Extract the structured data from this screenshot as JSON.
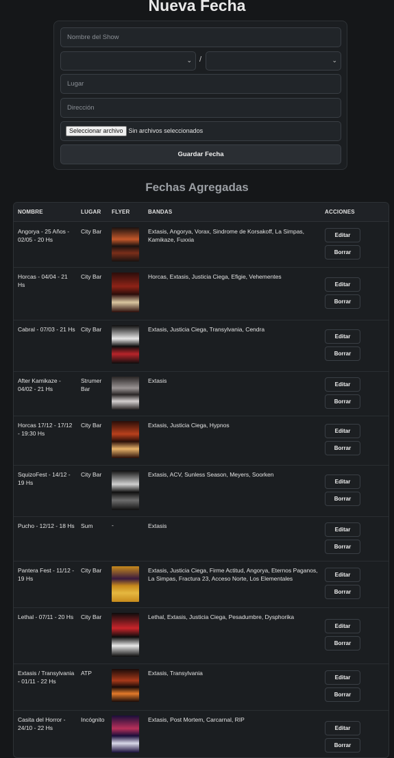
{
  "page": {
    "title": "Nueva Fecha"
  },
  "form": {
    "name_placeholder": "Nombre del Show",
    "separator": "/",
    "place_placeholder": "Lugar",
    "address_placeholder": "Dirección",
    "file_button": "Seleccionar archivo",
    "file_status": "Sin archivos seleccionados",
    "save_label": "Guardar Fecha"
  },
  "list": {
    "title": "Fechas Agregadas",
    "headers": {
      "name": "NOMBRE",
      "place": "LUGAR",
      "flyer": "FLYER",
      "bands": "BANDAS",
      "actions": "ACCIONES"
    },
    "edit_label": "Editar",
    "delete_label": "Borrar",
    "no_flyer": "-",
    "rows": [
      {
        "name": "Angorya - 25 Años - 02/05 - 20 Hs",
        "place": "City Bar",
        "bands": "Extasis, Angorya, Vorax, Sindrome de Korsakoff, La Simpas, Kamikaze, Fuxxia",
        "flyer_colors": [
          "#1a1210",
          "#c4582a",
          "#7a2e1a"
        ]
      },
      {
        "name": "Horcas - 04/04 - 21 Hs",
        "place": "City Bar",
        "bands": "Horcas, Extasis, Justicia Ciega, Efigie, Vehementes",
        "flyer_colors": [
          "#2b0d0a",
          "#8e2317",
          "#d9c6a0"
        ]
      },
      {
        "name": "Cabral - 07/03 - 21 Hs",
        "place": "City Bar",
        "bands": "Extasis, Justicia Ciega, Transylvania, Cendra",
        "flyer_colors": [
          "#0e0e0e",
          "#e8e8e8",
          "#b8242a"
        ]
      },
      {
        "name": "After Kamikaze - 04/02 - 21 Hs",
        "place": "Strumer Bar",
        "bands": "Extasis",
        "flyer_colors": [
          "#2a2626",
          "#9a9494",
          "#d4cfcf"
        ]
      },
      {
        "name": "Horcas 17/12 - 17/12 - 19:30 Hs",
        "place": "City Bar",
        "bands": "Extasis, Justicia Ciega, Hypnos",
        "flyer_colors": [
          "#2a0e08",
          "#b8401c",
          "#e7b36a"
        ]
      },
      {
        "name": "SquizoFest - 14/12 - 19 Hs",
        "place": "City Bar",
        "bands": "Extasis, ACV, Sunless Season, Meyers, Soorken",
        "flyer_colors": [
          "#101010",
          "#cfcfcf",
          "#6d6d6d"
        ]
      },
      {
        "name": "Pucho - 12/12 - 18 Hs",
        "place": "Sum",
        "bands": "Extasis",
        "flyer_colors": []
      },
      {
        "name": "Pantera Fest - 11/12 - 19 Hs",
        "place": "City Bar",
        "bands": "Extasis, Justicia Ciega, Firme Actitud, Angorya, Eternos Paganos, La Simpas, Fractura 23, Acceso Norte, Los Elementales",
        "flyer_colors": [
          "#c78a1c",
          "#3a1a3e",
          "#e5b840"
        ]
      },
      {
        "name": "Lethal - 07/11 - 20 Hs",
        "place": "City Bar",
        "bands": "Lethal, Extasis, Justicia Ciega, Pesadumbre, Dysphorika",
        "flyer_colors": [
          "#0c0c0c",
          "#c9252b",
          "#e9e9e9"
        ]
      },
      {
        "name": "Extasis / Transylvania - 01/11 - 22 Hs",
        "place": "ATP",
        "bands": "Extasis, Transylvania",
        "flyer_colors": [
          "#1a0b08",
          "#a83a1a",
          "#e37a2a"
        ]
      },
      {
        "name": "Casita del Horror - 24/10 - 22 Hs",
        "place": "Incógnito",
        "bands": "Extasis, Post Mortem, Carcarnal, RIP",
        "flyer_colors": [
          "#1a0e3a",
          "#b8305a",
          "#d8d8e8"
        ]
      }
    ]
  }
}
